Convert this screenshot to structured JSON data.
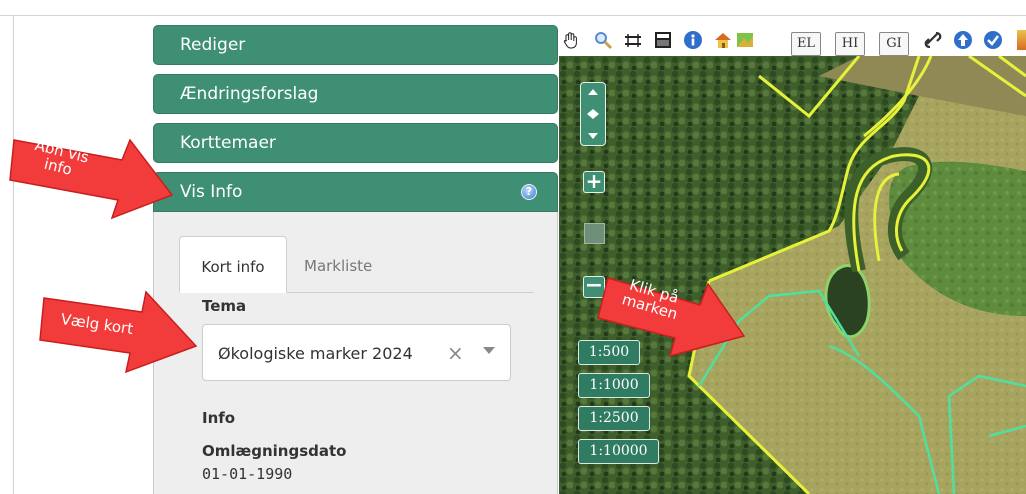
{
  "accordion": {
    "items": [
      {
        "label": "Rediger"
      },
      {
        "label": "Ændringsforslag"
      },
      {
        "label": "Korttemaer"
      },
      {
        "label": "Vis Info"
      }
    ],
    "help_icon": "?"
  },
  "info_panel": {
    "tabs": [
      {
        "label": "Kort info",
        "active": true
      },
      {
        "label": "Markliste",
        "active": false
      }
    ],
    "tema_label": "Tema",
    "tema_select": {
      "value": "Økologiske marker 2024",
      "clear": "×"
    },
    "info_heading": "Info",
    "field_label": "Omlægningsdato",
    "field_value": "01-01-1990"
  },
  "toolbar": {
    "icons": [
      "hand-pan-icon",
      "magnifier-icon",
      "measure-icon",
      "print-icon",
      "info-icon",
      "home-icon",
      "layers-icon",
      "link-icon",
      "up-arrow-icon",
      "check-icon"
    ],
    "text_buttons": [
      "EL",
      "HI",
      "GI"
    ]
  },
  "map_controls": {
    "zoom_in": "+",
    "zoom_out": "−",
    "scales": [
      "1:500",
      "1:1000",
      "1:2500",
      "1:10000"
    ]
  },
  "annotations": [
    {
      "text": "Åbn vis info"
    },
    {
      "text": "Vælg kort"
    },
    {
      "text": "Klik på marken"
    }
  ],
  "colors": {
    "accent": "#3f8f74",
    "field_outline": "#e6f23a",
    "organic_outline": "#4fe0a0",
    "arrow": "#f23b3b"
  }
}
